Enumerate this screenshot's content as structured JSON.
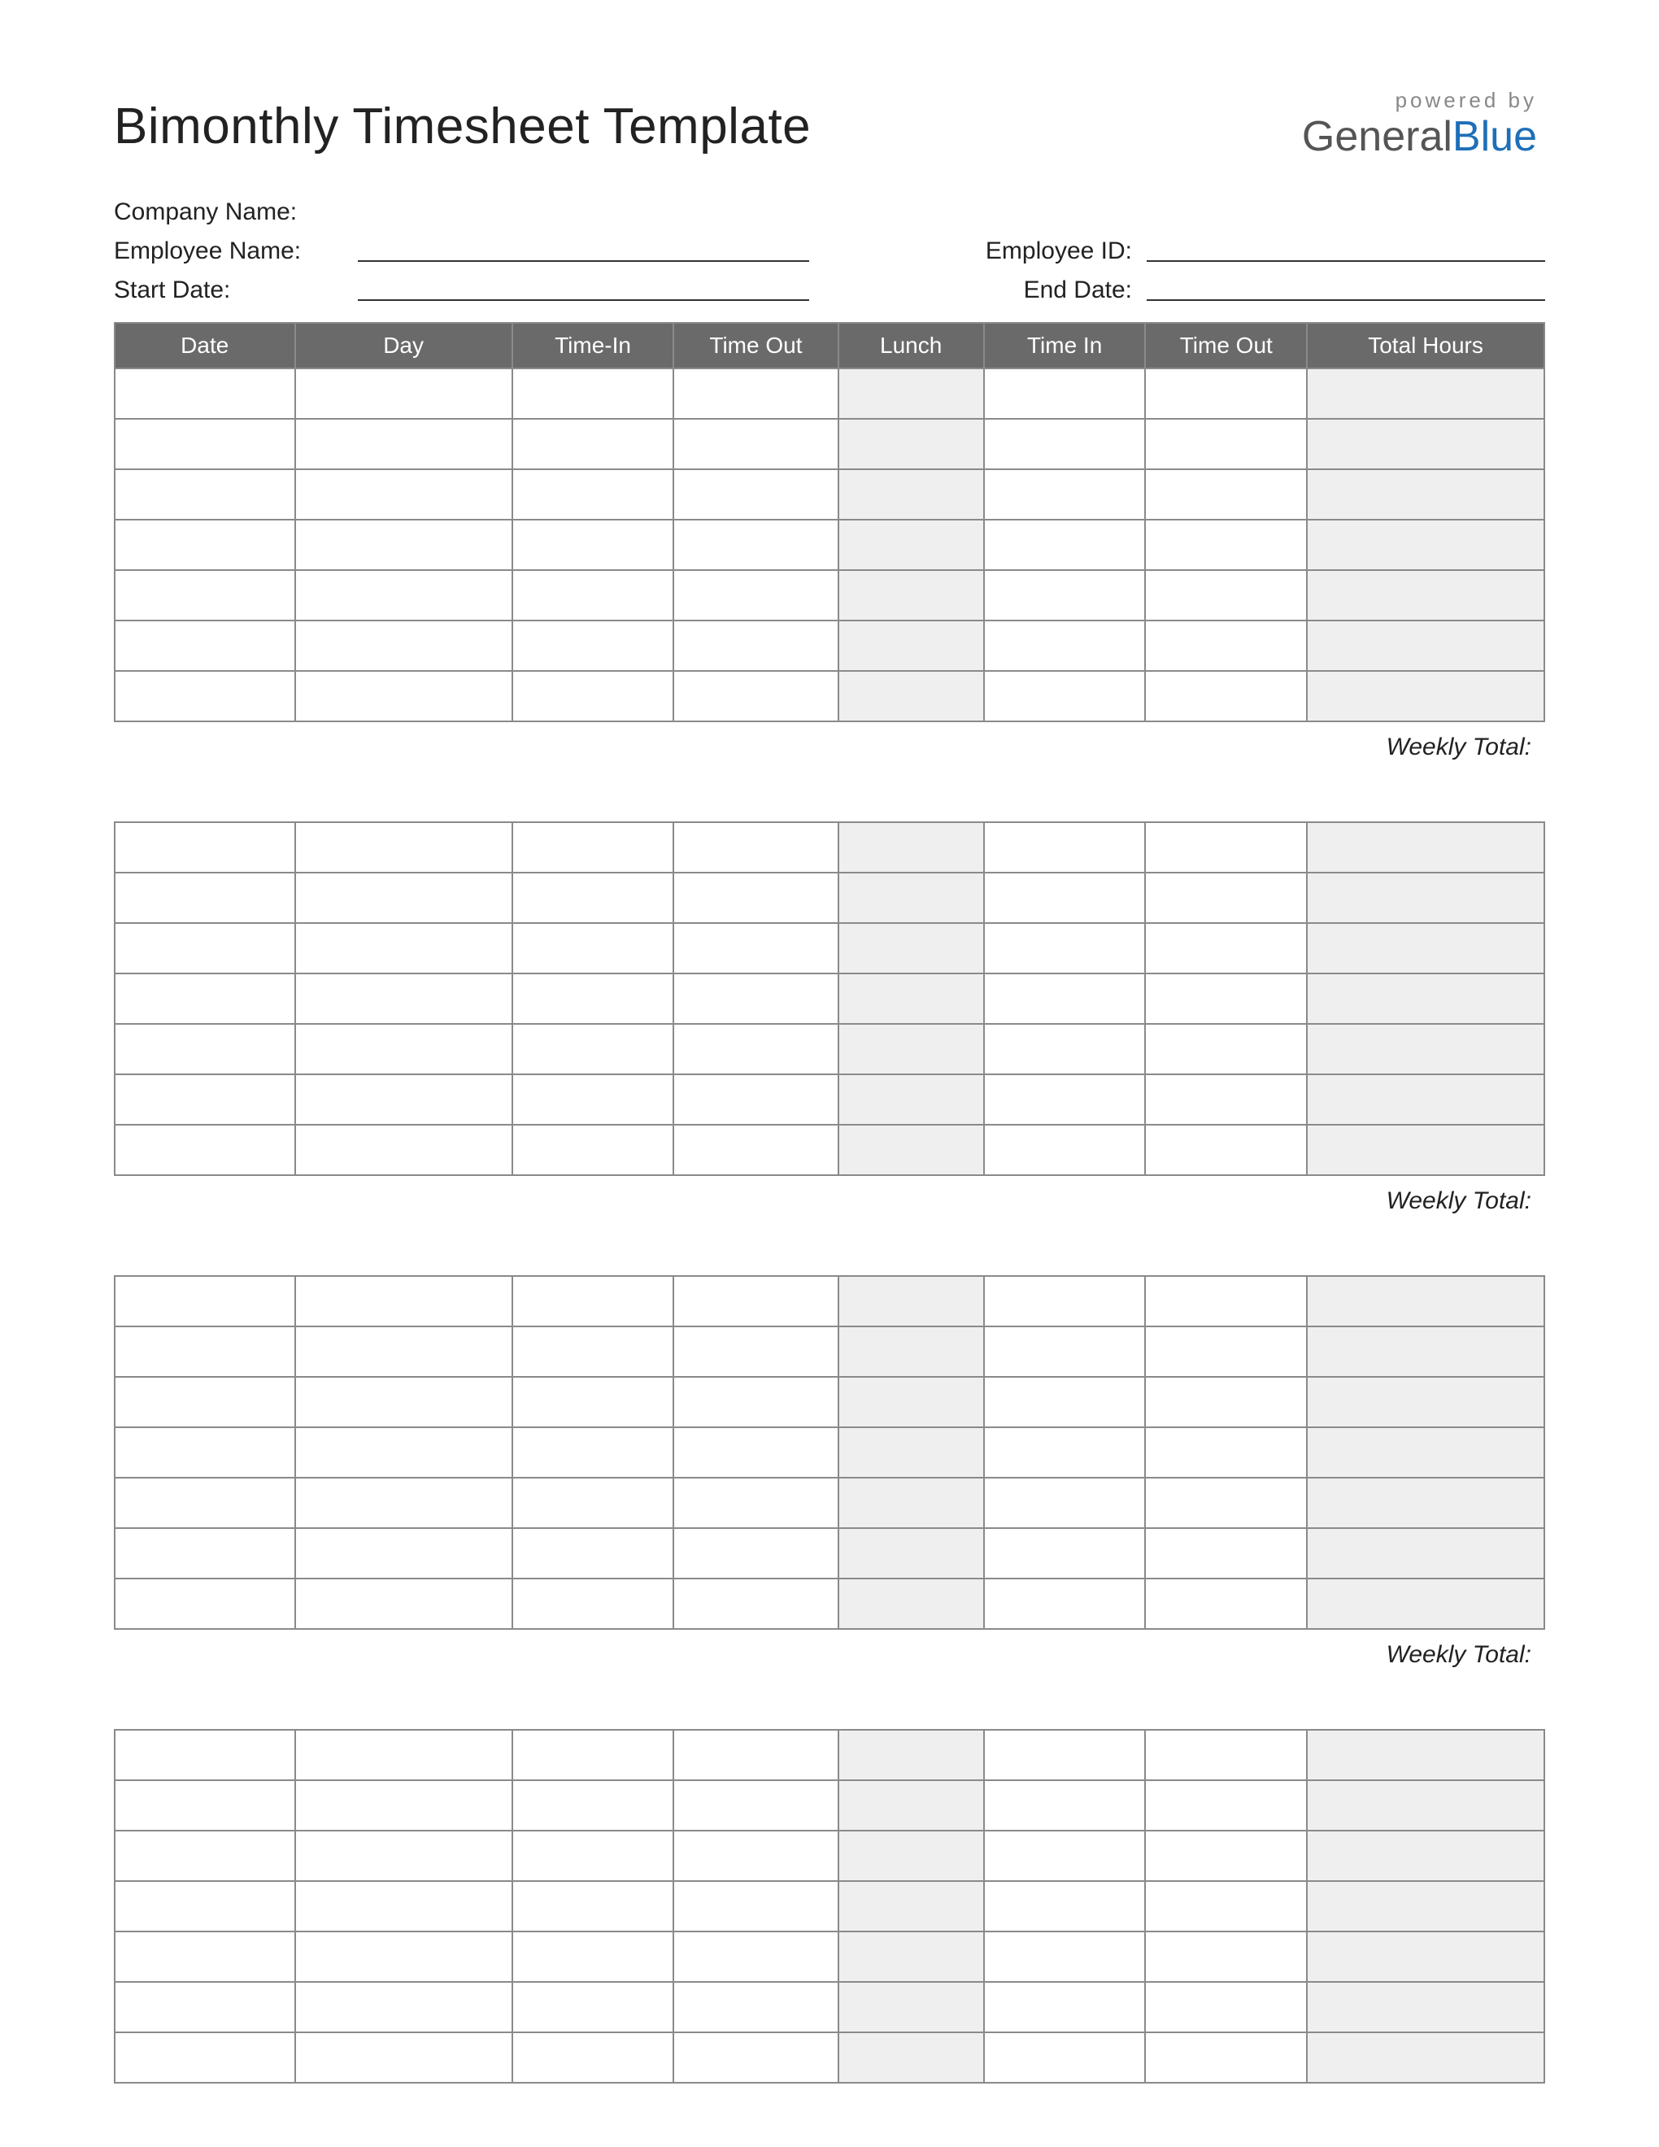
{
  "title": "Bimonthly Timesheet Template",
  "logo": {
    "powered": "powered by",
    "part1": "General",
    "part2": "Blue"
  },
  "meta": {
    "company_label": "Company Name:",
    "employee_label": "Employee Name:",
    "employee_id_label": "Employee ID:",
    "start_date_label": "Start Date:",
    "end_date_label": "End Date:"
  },
  "columns": {
    "date": "Date",
    "day": "Day",
    "time_in_1": "Time-In",
    "time_out_1": "Time Out",
    "lunch": "Lunch",
    "time_in_2": "Time In",
    "time_out_2": "Time Out",
    "total_hours": "Total Hours"
  },
  "weekly_total_label": "Weekly Total:",
  "sections": [
    {
      "rows": 7,
      "show_weekly_total": true
    },
    {
      "rows": 7,
      "show_weekly_total": true
    },
    {
      "rows": 7,
      "show_weekly_total": true
    },
    {
      "rows": 7,
      "show_weekly_total": false
    }
  ]
}
